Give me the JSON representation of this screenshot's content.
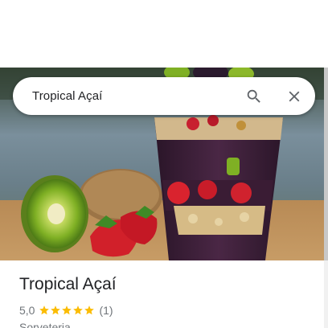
{
  "search": {
    "query": "Tropical Açaí"
  },
  "place": {
    "name": "Tropical Açaí",
    "rating": "5,0",
    "rating_stars": 5,
    "review_count": "(1)",
    "category": "Sorveteria"
  },
  "icons": {
    "search": "search-icon",
    "close": "close-icon",
    "star": "star-icon"
  },
  "colors": {
    "star": "#fbbc04",
    "text_primary": "#202124",
    "text_secondary": "#70757a"
  }
}
